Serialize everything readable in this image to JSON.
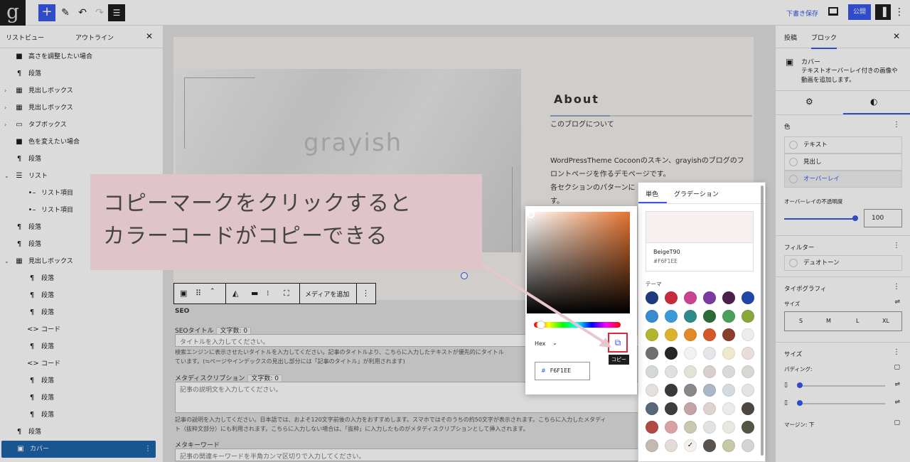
{
  "topbar": {
    "logo_letter": "g",
    "draft_label": "下書き保存",
    "publish_label": "公開"
  },
  "left_panel": {
    "tabs": [
      "リストビュー",
      "アウトライン"
    ],
    "items": [
      {
        "icon": "bookmark-icon",
        "label": "高さを調整したい場合",
        "indent": 0,
        "chevron": false
      },
      {
        "icon": "paragraph-icon",
        "label": "段落",
        "indent": 0,
        "chevron": false
      },
      {
        "icon": "table-icon",
        "label": "見出しボックス",
        "indent": 0,
        "chevron": true
      },
      {
        "icon": "table-icon",
        "label": "見出しボックス",
        "indent": 0,
        "chevron": true
      },
      {
        "icon": "folder-icon",
        "label": "タブボックス",
        "indent": 0,
        "chevron": true
      },
      {
        "icon": "bookmark-icon",
        "label": "色を変えたい場合",
        "indent": 0,
        "chevron": false
      },
      {
        "icon": "paragraph-icon",
        "label": "段落",
        "indent": 0,
        "chevron": false
      },
      {
        "icon": "list-icon",
        "label": "リスト",
        "indent": 0,
        "chevron": true
      },
      {
        "icon": "list-item-icon",
        "label": "リスト項目",
        "indent": 1,
        "chevron": false
      },
      {
        "icon": "list-item-icon",
        "label": "リスト項目",
        "indent": 1,
        "chevron": false
      },
      {
        "icon": "paragraph-icon",
        "label": "段落",
        "indent": 0,
        "chevron": false
      },
      {
        "icon": "paragraph-icon",
        "label": "段落",
        "indent": 0,
        "chevron": false
      },
      {
        "icon": "table-icon",
        "label": "見出しボックス",
        "indent": 0,
        "chevron": true
      },
      {
        "icon": "paragraph-icon",
        "label": "段落",
        "indent": 1,
        "chevron": false
      },
      {
        "icon": "paragraph-icon",
        "label": "段落",
        "indent": 1,
        "chevron": false
      },
      {
        "icon": "paragraph-icon",
        "label": "段落",
        "indent": 1,
        "chevron": false
      },
      {
        "icon": "code-icon",
        "label": "コード",
        "indent": 1,
        "chevron": false
      },
      {
        "icon": "paragraph-icon",
        "label": "段落",
        "indent": 1,
        "chevron": false
      },
      {
        "icon": "code-icon",
        "label": "コード",
        "indent": 1,
        "chevron": false
      },
      {
        "icon": "paragraph-icon",
        "label": "段落",
        "indent": 1,
        "chevron": false
      },
      {
        "icon": "paragraph-icon",
        "label": "段落",
        "indent": 1,
        "chevron": false
      },
      {
        "icon": "paragraph-icon",
        "label": "段落",
        "indent": 1,
        "chevron": false
      },
      {
        "icon": "paragraph-icon",
        "label": "段落",
        "indent": 0,
        "chevron": false
      },
      {
        "icon": "cover-icon",
        "label": "カバー",
        "indent": 0,
        "chevron": true,
        "selected": true
      }
    ]
  },
  "canvas": {
    "brand": "grayish",
    "about_title": "About",
    "about_sub": "このブログについて",
    "about_text": [
      "WordPressTheme Cocoonのスキン、grayishのブログのフ",
      "ロントページを作るデモページです。",
      "各セクションのパターンに",
      "す。"
    ],
    "toolbar_media_label": "メディアを追加",
    "seo": {
      "heading": "SEO",
      "title_label": "SEOタイトル",
      "title_count": "文字数: 0",
      "title_placeholder": "タイトルを入力してください。",
      "title_help": "検索エンジンに表示させたいタイトルを入力してください。記事のタイトルより、こちらに入力したテキストが優先的にタイトル\nています。(≒ページやインデックスの見出し部分には「記事のタイトル」が利用されます)",
      "desc_label": "メタディスクリプション",
      "desc_count": "文字数: 0",
      "desc_placeholder": "記事の説明文を入力してください。",
      "desc_help": "記事の説明を入力してください。日本語では、およそ120文字前後の入力をおすすめします。スマホではそのうちの約50文字が表示されます。こちらに入力したメタディ\nト（抜粋文部分）にも利用されます。こちらに入力しない場合は、「抜粋」に入力したものがメタディスクリプションとして挿入されます。",
      "keyword_label": "メタキーワード",
      "keyword_placeholder": "記事の関連キーワードを半角カンマ区切りで入力してください。"
    }
  },
  "right_panel": {
    "tabs": [
      "投稿",
      "ブロック"
    ],
    "block_name": "カバー",
    "block_desc": "テキストオーバーレイ付きの画像や動画を追加します。",
    "color_title": "色",
    "color_items": [
      "テキスト",
      "見出し",
      "オーバーレイ"
    ],
    "overlay_opacity_label": "オーバーレイの不透明度",
    "overlay_opacity_value": "100",
    "overlay_opacity_percent": 100,
    "filter_title": "フィルター",
    "duotone_label": "デュオトーン",
    "typography_title": "タイポグラフィ",
    "size_label": "サイズ",
    "size_options": [
      "S",
      "M",
      "L",
      "XL"
    ],
    "dimensions_title": "サイズ",
    "padding_label": "パディング:",
    "margin_label": "マージン: 下"
  },
  "palette": {
    "tabs": [
      "単色",
      "グラデーション"
    ],
    "selected_name": "BeigeT90",
    "selected_hex": "#F6F1EE",
    "theme_label": "テーマ",
    "colors": [
      "#1f3b7d",
      "#c62b3b",
      "#c9438f",
      "#7a3aa0",
      "#4d1f4d",
      "#2046a6",
      "#3a8ad0",
      "#3b9ad6",
      "#2f8a8a",
      "#2c6a3a",
      "#4aa058",
      "#8aa83a",
      "#b2b52e",
      "#dcb22a",
      "#e08a2a",
      "#d4572a",
      "#8a3f2a",
      "#ececec",
      "#6f6f6f",
      "#262626",
      "#f2f2f2",
      "#e4e6ea",
      "#eee8cc",
      "#eadcd8",
      "#d4d8d8",
      "#e0e0e0",
      "#e2e2d6",
      "#d8d0cc",
      "#dadada",
      "#d6d8d2",
      "#e3e0de",
      "#3a3a3a",
      "#8a8888",
      "#a8b8c6",
      "#d2dbe0",
      "#e4e4e4",
      "#56687a",
      "#3e3e3e",
      "#c2a3a8",
      "#e0d2ce",
      "#ebebeb",
      "#4e4642",
      "#b04a44",
      "#d9a3a3",
      "#c9c9b2",
      "#e2e2e2",
      "#e8e8e2",
      "#555545",
      "#c4b8b0",
      "#e2dcd6",
      "#f6f1ee",
      "#5a5450",
      "#c8c8a8",
      "#d4d4d4"
    ],
    "selected_index": 50
  },
  "picker": {
    "hex_label": "Hex",
    "hex_value": "F6F1EE",
    "hex_hash": "#",
    "copy_tooltip": "コピー"
  },
  "callout": {
    "line1": "コピーマークをクリックすると",
    "line2": "カラーコードがコピーできる",
    "color": "#dfc5c9",
    "arrow_color": "#e7c6ce"
  }
}
